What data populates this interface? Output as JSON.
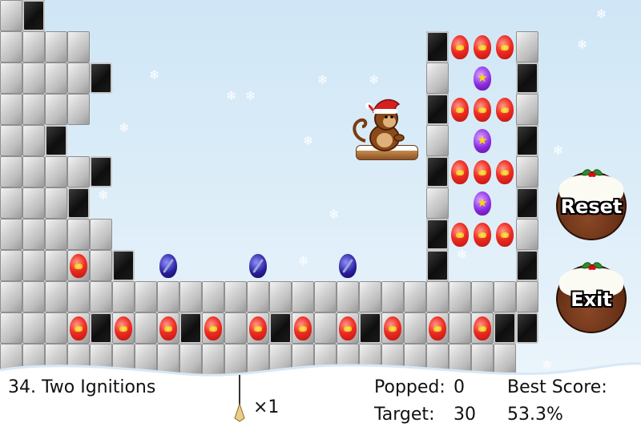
{
  "hud": {
    "level_title": "34. Two Ignitions",
    "darts_count": "×1",
    "popped_label": "Popped:",
    "popped_value": "0",
    "target_label": "Target:",
    "target_value": "30",
    "best_label": "Best Score:",
    "best_value": "53.3%"
  },
  "buttons": {
    "reset": "Reset",
    "exit": "Exit"
  },
  "icons": {
    "dart": "dart-icon",
    "monkey": "santa-monkey",
    "pudding": "christmas-pudding-icon"
  },
  "colors": {
    "sky_top": "#cfe6f6",
    "stone": "#c4c4c4",
    "dark_block": "#111111",
    "balloon_red": "#ee2b22",
    "balloon_purple": "#8a2be2",
    "balloon_blue": "#2a1e9c",
    "pudding": "#5e2a12"
  }
}
